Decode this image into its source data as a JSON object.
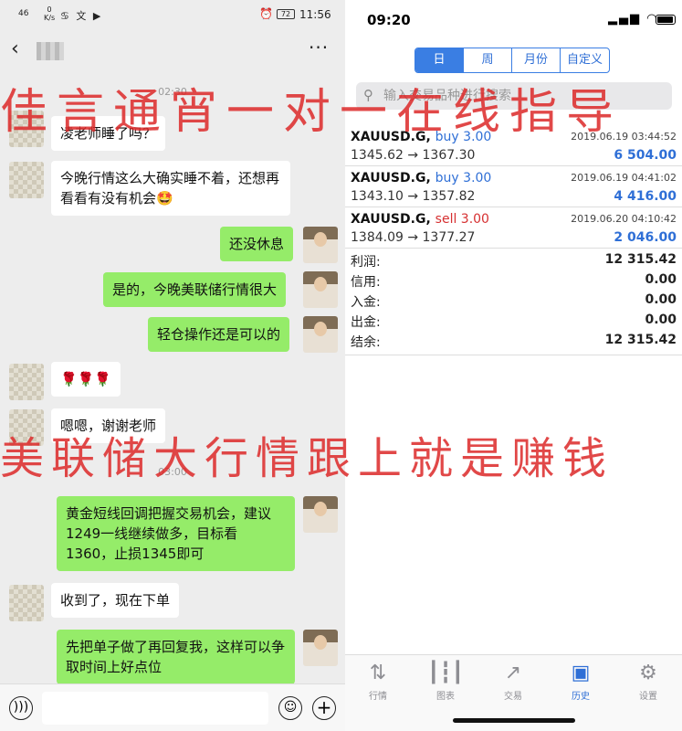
{
  "chat": {
    "status": {
      "signal": "46",
      "speed_value": "0",
      "speed_unit": "K/s",
      "battery": "72",
      "time": "11:56"
    },
    "timestamps": [
      "02:30",
      "03:00"
    ],
    "messages": [
      {
        "side": "in",
        "text": "凌老师睡了吗？"
      },
      {
        "side": "in",
        "text": "今晚行情这么大确实睡不着，还想再看看有没有机会🤩"
      },
      {
        "side": "out",
        "text": "还没休息"
      },
      {
        "side": "out",
        "text": "是的，今晚美联储行情很大"
      },
      {
        "side": "out",
        "text": "轻仓操作还是可以的"
      },
      {
        "side": "in",
        "text": "🌹🌹🌹"
      },
      {
        "side": "in",
        "text": "嗯嗯，谢谢老师"
      },
      {
        "side": "out",
        "text": "黄金短线回调把握交易机会，建议1249一线继续做多，目标看1360，止损1345即可"
      },
      {
        "side": "in",
        "text": "收到了，现在下单"
      },
      {
        "side": "out",
        "text": "先把单子做了再回复我，这样可以争取时间上好点位"
      }
    ],
    "input": {
      "value": ""
    }
  },
  "mt4": {
    "status_time": "09:20",
    "segments": [
      "日",
      "周",
      "月份",
      "自定义"
    ],
    "active_segment": "日",
    "search_placeholder": "输入交易品种进行搜索",
    "deals": [
      {
        "symbol": "XAUUSD.G,",
        "type": "buy",
        "volume": "3.00",
        "datetime": "2019.06.19 03:44:52",
        "prices": "1345.62 → 1367.30",
        "profit": "6 504.00"
      },
      {
        "symbol": "XAUUSD.G,",
        "type": "buy",
        "volume": "3.00",
        "datetime": "2019.06.19 04:41:02",
        "prices": "1343.10 → 1357.82",
        "profit": "4 416.00"
      },
      {
        "symbol": "XAUUSD.G,",
        "type": "sell",
        "volume": "3.00",
        "datetime": "2019.06.20 04:10:42",
        "prices": "1384.09 → 1377.27",
        "profit": "2 046.00"
      }
    ],
    "summary": [
      {
        "label": "利润:",
        "value": "12 315.42"
      },
      {
        "label": "信用:",
        "value": "0.00"
      },
      {
        "label": "入金:",
        "value": "0.00"
      },
      {
        "label": "出金:",
        "value": "0.00"
      },
      {
        "label": "结余:",
        "value": "12 315.42"
      }
    ],
    "tabs": [
      {
        "label": "行情",
        "icon": "arrows-icon"
      },
      {
        "label": "图表",
        "icon": "candles-icon"
      },
      {
        "label": "交易",
        "icon": "trade-icon"
      },
      {
        "label": "历史",
        "icon": "inbox-icon"
      },
      {
        "label": "设置",
        "icon": "gear-icon"
      }
    ],
    "active_tab": "历史",
    "colors": {
      "accent": "#3a7ee3",
      "buy": "#2f6fd6",
      "sell": "#d63031",
      "bubble_out": "#95ec69"
    }
  },
  "watermarks": {
    "top": "佳言通宵一对一在线指导",
    "middle": "美联储大行情跟上就是赚钱"
  }
}
